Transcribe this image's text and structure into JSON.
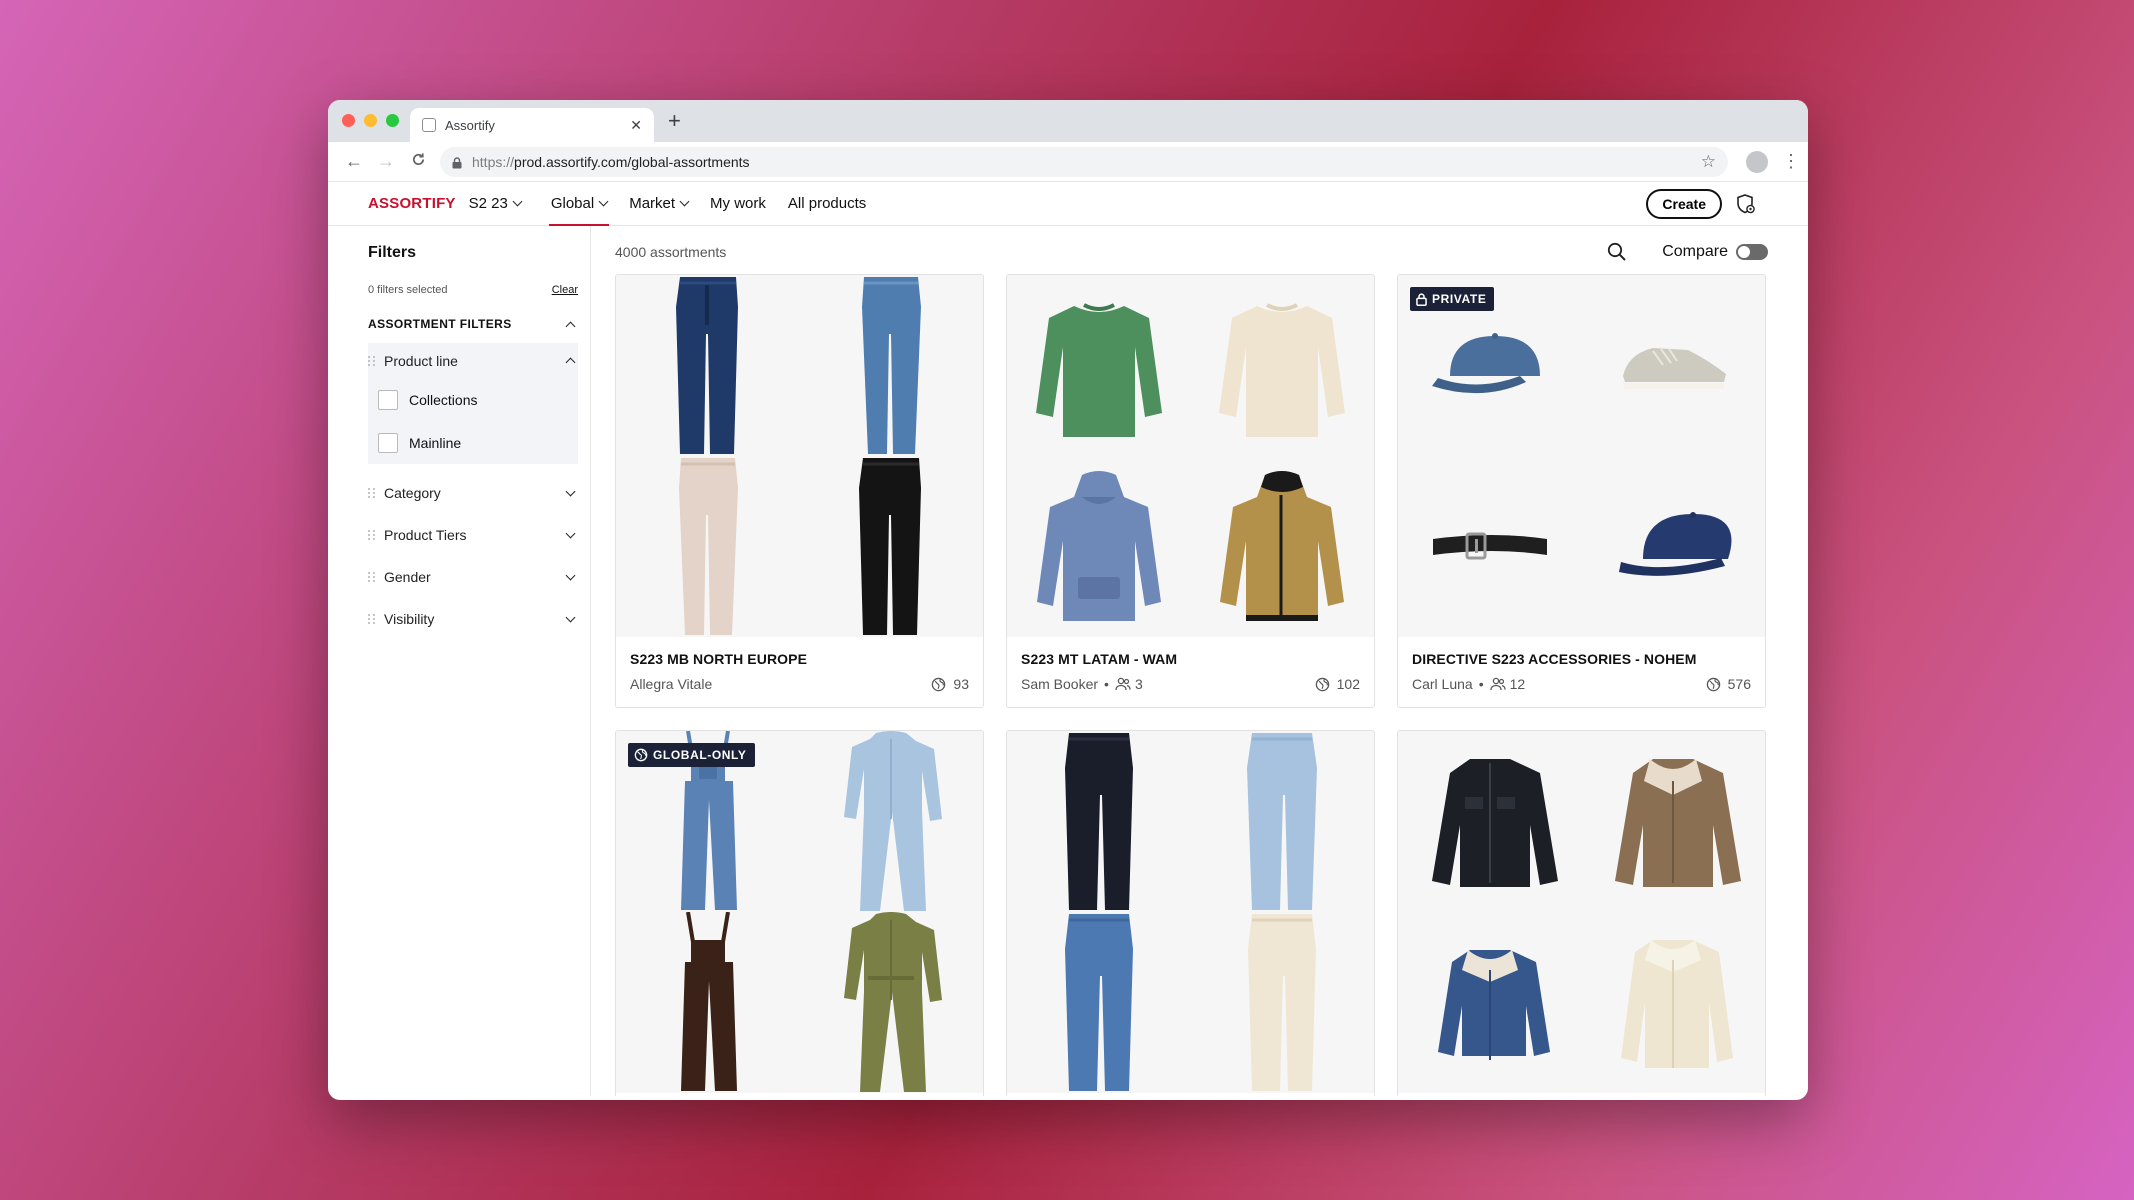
{
  "browser": {
    "tab_title": "Assortify",
    "url_scheme": "https://",
    "url_rest": "prod.assortify.com/global-assortments"
  },
  "header": {
    "logo": "ASSORTIFY",
    "season": "S2 23",
    "nav": [
      {
        "label": "Global",
        "active": true
      },
      {
        "label": "Market"
      },
      {
        "label": "My work"
      },
      {
        "label": "All products"
      }
    ],
    "create_label": "Create"
  },
  "sidebar": {
    "title": "Filters",
    "selected_text": "0 filters selected",
    "clear_label": "Clear",
    "section_title": "ASSORTMENT FILTERS",
    "product_line": {
      "label": "Product line",
      "options": [
        "Collections",
        "Mainline"
      ]
    },
    "collapsed_filters": [
      "Category",
      "Product Tiers",
      "Gender",
      "Visibility"
    ]
  },
  "main": {
    "count_text": "4000 assortments",
    "compare_label": "Compare",
    "compare_on": false
  },
  "cards": [
    {
      "title": "S223 MB NORTH EUROPE",
      "owner": "Allegra Vitale",
      "users": "",
      "count": "93",
      "badge": ""
    },
    {
      "title": "S223 MT LATAM - WAM",
      "owner": "Sam Booker",
      "users": "3",
      "count": "102",
      "badge": ""
    },
    {
      "title": "DIRECTIVE S223 ACCESSORIES - NOHEM",
      "owner": "Carl Luna",
      "users": "12",
      "count": "576",
      "badge": "PRIVATE"
    },
    {
      "badge": "GLOBAL-ONLY"
    },
    {
      "badge": ""
    },
    {
      "badge": ""
    }
  ],
  "colors": {
    "brand": "#c8102e",
    "badge_bg": "#1b2238"
  }
}
